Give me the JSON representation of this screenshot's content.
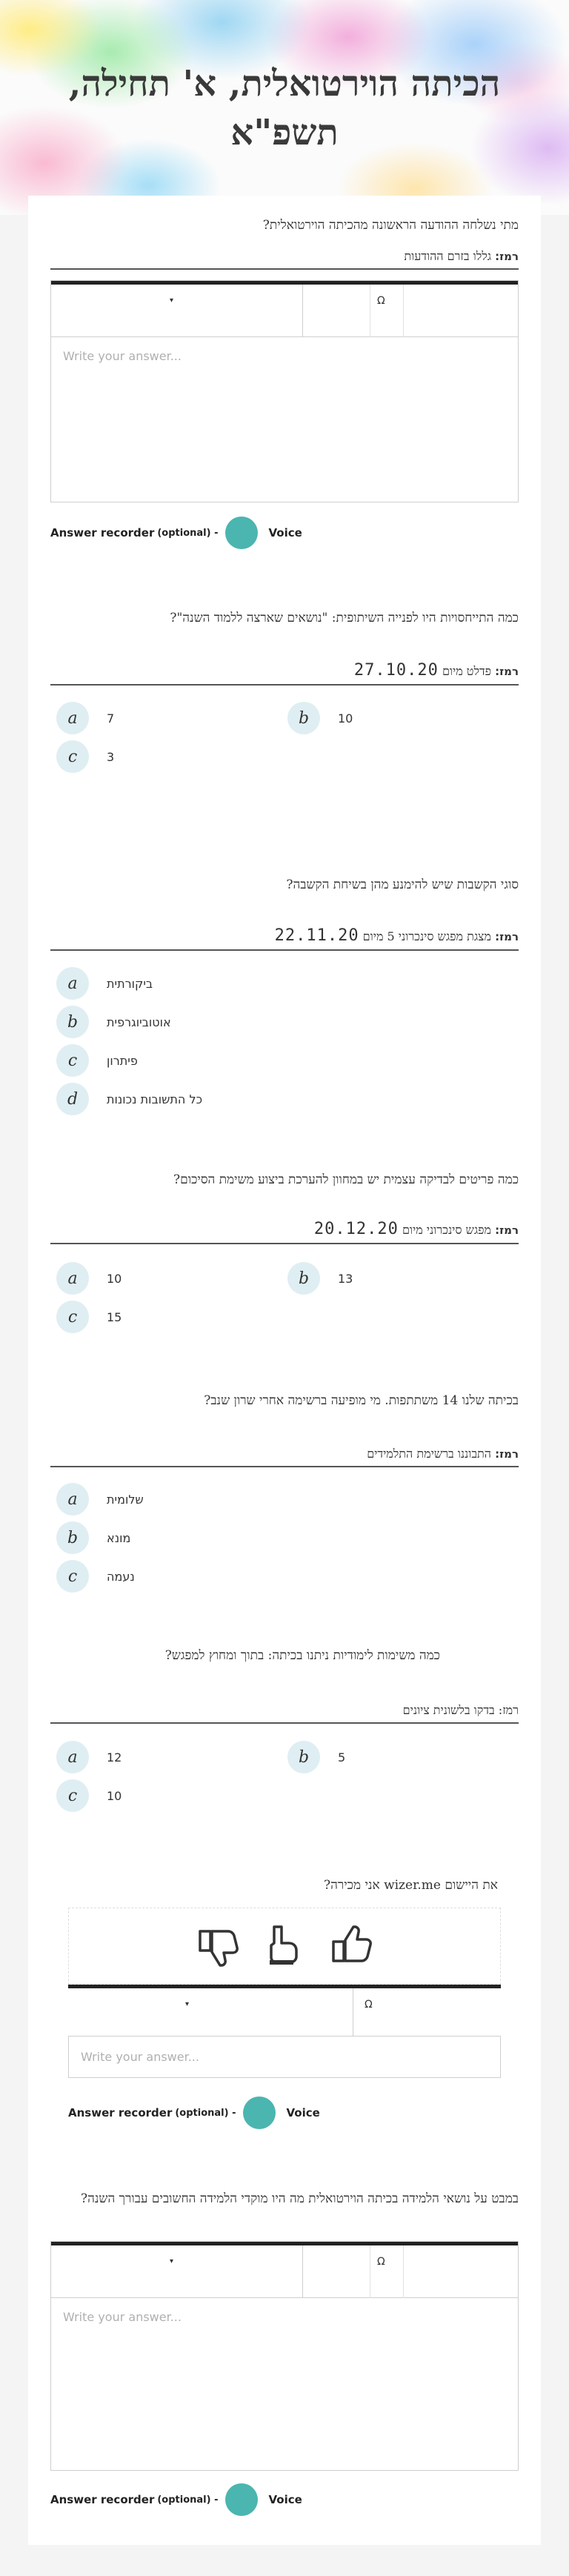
{
  "header": {
    "title": "הכיתה הוירטואלית, א' תחילה, תשפ\"א"
  },
  "editor": {
    "placeholder": "Write your answer...",
    "dropdown_arrow": "▾",
    "omega_icon": "Ω"
  },
  "recorder": {
    "label": "Answer recorder",
    "optional": "(optional) -",
    "voice": "Voice"
  },
  "questions": [
    {
      "text": "מתי נשלחה ההודעה הראשונה מהכיתה הוירטואלית?",
      "hint_label": "רמז:",
      "hint_text": "גללו בזרם ההודעות"
    },
    {
      "text": "כמה התייחסויות היו לפנייה השיתופית: \"נושאים שארצה ללמוד השנה\"?",
      "hint_label": "רמז:",
      "hint_text": "פדלט מיום",
      "hint_hand": "27.10.20",
      "options": [
        {
          "letter": "a",
          "label": "7"
        },
        {
          "letter": "b",
          "label": "10"
        },
        {
          "letter": "c",
          "label": "3"
        }
      ]
    },
    {
      "text": "סוגי הקשבות שיש להימנע מהן בשיחת הקשבה?",
      "hint_label": "רמז:",
      "hint_text": "מצגת מפגש סינכרוני 5 מיום",
      "hint_hand": "22.11.20",
      "options": [
        {
          "letter": "a",
          "label": "ביקורתית"
        },
        {
          "letter": "b",
          "label": "אוטוביוגרפית"
        },
        {
          "letter": "c",
          "label": "פיתרון"
        },
        {
          "letter": "d",
          "label": "כל התשובות נכונות"
        }
      ]
    },
    {
      "text": "כמה פריטים לבדיקה עצמית יש במחוון להערכת ביצוע משימת הסיכום?",
      "hint_label": "רמז:",
      "hint_text": "מפגש סינכרוני מיום",
      "hint_hand": "20.12.20",
      "options": [
        {
          "letter": "a",
          "label": "10"
        },
        {
          "letter": "b",
          "label": "13"
        },
        {
          "letter": "c",
          "label": "15"
        }
      ]
    },
    {
      "text": "בכיתה שלנו 14 משתתפות. מי מופיעה ברשימה אחרי שרון שנב?",
      "hint_label": "רמז:",
      "hint_text": "התבוננו ברשימת התלמידים",
      "options": [
        {
          "letter": "a",
          "label": "שלומית"
        },
        {
          "letter": "b",
          "label": "מונא"
        },
        {
          "letter": "c",
          "label": "נעמה"
        }
      ]
    },
    {
      "text": "כמה משימות לימודיות ניתנו בכיתה: בתוך ומחוץ למפגש?",
      "hint_text": "רמז: בדקו בלשונית ציונים",
      "options": [
        {
          "letter": "a",
          "label": "12"
        },
        {
          "letter": "b",
          "label": "5"
        },
        {
          "letter": "c",
          "label": "10"
        }
      ]
    },
    {
      "text": "את היישום wizer.me אני מכירה?"
    },
    {
      "text": "במבט על נושאי הלמידה בכיתה הוירטואלית מה היו מוקדי הלמידה החשובים עבורך השנה?"
    }
  ]
}
